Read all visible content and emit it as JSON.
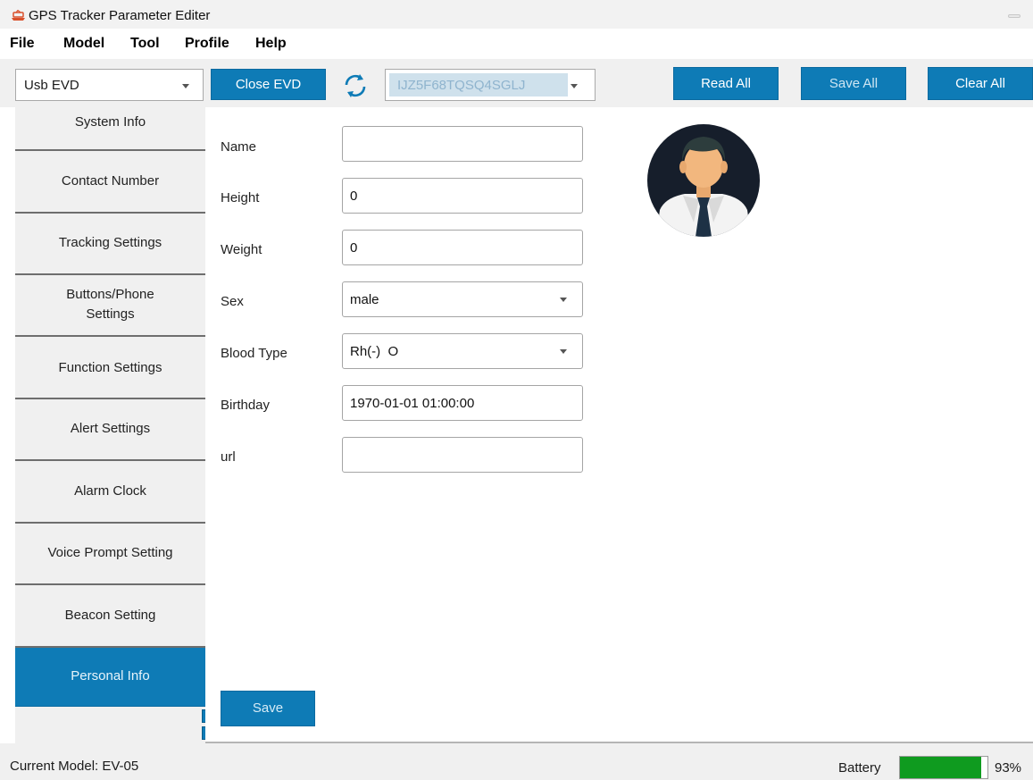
{
  "window": {
    "title": "GPS Tracker Parameter Editer"
  },
  "menu": [
    "File",
    "Model",
    "Tool",
    "Profile",
    "Help"
  ],
  "toolbar": {
    "connection_value": "Usb EVD",
    "close_button": "Close EVD",
    "device_id": "IJZ5F68TQSQ4SGLJ",
    "read_all": "Read All",
    "save_all": "Save All",
    "clear_all": "Clear All"
  },
  "sidebar": {
    "items": [
      {
        "label": "System Info",
        "active": false
      },
      {
        "label": "Contact Number",
        "active": false
      },
      {
        "label": "Tracking Settings",
        "active": false
      },
      {
        "label": "Buttons/Phone\nSettings",
        "active": false
      },
      {
        "label": "Function Settings",
        "active": false
      },
      {
        "label": "Alert Settings",
        "active": false
      },
      {
        "label": "Alarm Clock",
        "active": false
      },
      {
        "label": "Voice Prompt Setting",
        "active": false
      },
      {
        "label": "Beacon Setting",
        "active": false
      },
      {
        "label": "Personal Info",
        "active": true
      }
    ]
  },
  "form": {
    "fields": [
      {
        "label": "Name",
        "value": "",
        "type": "text"
      },
      {
        "label": "Height",
        "value": "0",
        "type": "text"
      },
      {
        "label": "Weight",
        "value": "0",
        "type": "text"
      },
      {
        "label": "Sex",
        "value": "male",
        "type": "select"
      },
      {
        "label": "Blood Type",
        "value": "Rh(-)  O",
        "type": "select"
      },
      {
        "label": "Birthday",
        "value": "1970-01-01 01:00:00",
        "type": "text"
      },
      {
        "label": "url",
        "value": "",
        "type": "text"
      }
    ],
    "save_button": "Save"
  },
  "status": {
    "current_model": "Current Model: EV-05",
    "battery_label": "Battery",
    "battery_percent": "93%",
    "battery_level": 0.93
  },
  "colors": {
    "accent": "#0e7bb6",
    "battery_fill": "#0f9b1f"
  },
  "icons": {
    "app": "app-logo-icon",
    "refresh": "refresh-icon",
    "avatar": "user-avatar-icon"
  }
}
